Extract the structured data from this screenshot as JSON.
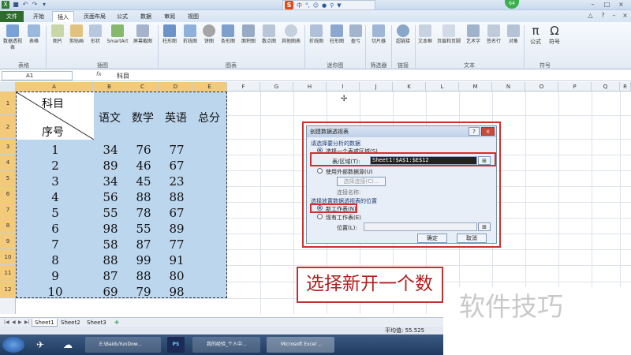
{
  "title_bar": {
    "badge": "64",
    "ime_chars": [
      "中",
      "°,",
      "☺",
      "⚲"
    ]
  },
  "tabs": [
    "文件",
    "开始",
    "插入",
    "页面布局",
    "公式",
    "数据",
    "审阅",
    "视图"
  ],
  "ribbon": {
    "buttons": [
      "数据透视表",
      "表格",
      "图片",
      "剪贴画",
      "形状",
      "SmartArt",
      "屏幕截图",
      "柱形图",
      "折线图",
      "饼图",
      "条形图",
      "面积图",
      "散点图",
      "其他图表",
      "折线图",
      "柱形图",
      "盈亏",
      "切片器",
      "超链接",
      "文本框",
      "页眉和页脚",
      "艺术字",
      "签名行",
      "对象",
      "公式",
      "符号"
    ],
    "groups": [
      "表格",
      "插图",
      "图表",
      "迷你图",
      "筛选器",
      "链接",
      "文本",
      "符号"
    ]
  },
  "formula_bar": {
    "name_box": "A1",
    "fx": "fx",
    "value": "科目"
  },
  "columns": [
    "A",
    "B",
    "C",
    "D",
    "E",
    "F",
    "G",
    "H",
    "I",
    "J",
    "K",
    "L",
    "M",
    "N",
    "O",
    "P",
    "Q",
    "R"
  ],
  "rows": [
    "1",
    "2",
    "3",
    "4",
    "5",
    "6",
    "7",
    "8",
    "9",
    "10",
    "11",
    "12"
  ],
  "sheet": {
    "corner_top": "科目",
    "corner_bottom": "序号",
    "headers": [
      "语文",
      "数学",
      "英语",
      "总分"
    ],
    "data": [
      [
        "1",
        "34",
        "76",
        "77"
      ],
      [
        "2",
        "89",
        "46",
        "67"
      ],
      [
        "3",
        "34",
        "45",
        "23"
      ],
      [
        "4",
        "56",
        "88",
        "88"
      ],
      [
        "5",
        "55",
        "78",
        "67"
      ],
      [
        "6",
        "98",
        "55",
        "89"
      ],
      [
        "7",
        "58",
        "87",
        "77"
      ],
      [
        "8",
        "88",
        "99",
        "91"
      ],
      [
        "9",
        "87",
        "88",
        "80"
      ],
      [
        "10",
        "69",
        "79",
        "98"
      ]
    ]
  },
  "dialog": {
    "title": "创建数据透视表",
    "help": "?",
    "close": "×",
    "section1": "请选择要分析的数据",
    "opt_select": "选择一个表或区域(S)",
    "range_label": "表/区域(T):",
    "range_value": "Sheet1!$A$1:$E$12",
    "opt_external": "使用外部数据源(U)",
    "choose_conn": "选择连接(C)...",
    "conn_name": "连接名称:",
    "section2": "选择放置数据透视表的位置",
    "opt_new": "新工作表(N)",
    "opt_existing": "现有工作表(E)",
    "location_label": "位置(L):",
    "ok": "确定",
    "cancel": "取消"
  },
  "caption": "选择新开一个数",
  "watermark": "软件技巧",
  "sheet_tabs": [
    "Sheet1",
    "Sheet2",
    "Sheet3"
  ],
  "status": {
    "average": "平均值: 55.525"
  },
  "taskbar": [
    {
      "label": "E:\\BaiduYunDow..."
    },
    {
      "label": "PS"
    },
    {
      "label": "我的经验_个人中..."
    },
    {
      "label": "Microsoft Excel ..."
    }
  ]
}
